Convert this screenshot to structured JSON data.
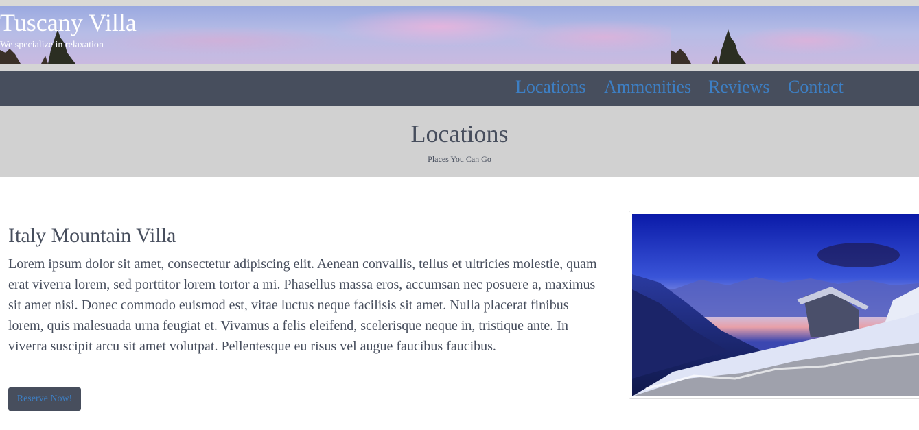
{
  "site": {
    "title": "Tuscany Villa",
    "tagline": "We specialize in relaxation"
  },
  "nav": {
    "items": [
      {
        "label": "Locations"
      },
      {
        "label": "Ammenities"
      },
      {
        "label": "Reviews"
      },
      {
        "label": "Contact"
      }
    ]
  },
  "section": {
    "title": "Locations",
    "subtitle": "Places You Can Go"
  },
  "location_card": {
    "title": "Italy Mountain Villa",
    "description": "Lorem ipsum dolor sit amet, consectetur adipiscing elit. Aenean convallis, tellus et ultricies molestie, quam erat viverra lorem, sed porttitor lorem tortor a mi. Phasellus massa eros, accumsan nec posuere a, maximus sit amet nisi. Donec commodo euismod est, vitae luctus neque facilisis sit amet. Nulla placerat finibus lorem, quis malesuada urna feugiat et. Vivamus a felis eleifend, scelerisque neque in, tristique ante. In viverra suscipit arcu sit amet volutpat. Pellentesque eu risus vel augue faucibus faucibus.",
    "button_label": "Reserve Now!",
    "image_icon": "mountain-landscape-image"
  },
  "colors": {
    "nav_background": "#474e5d",
    "link": "#3d7fc4",
    "section_background": "#d1d1d1",
    "text": "#474e5d"
  }
}
